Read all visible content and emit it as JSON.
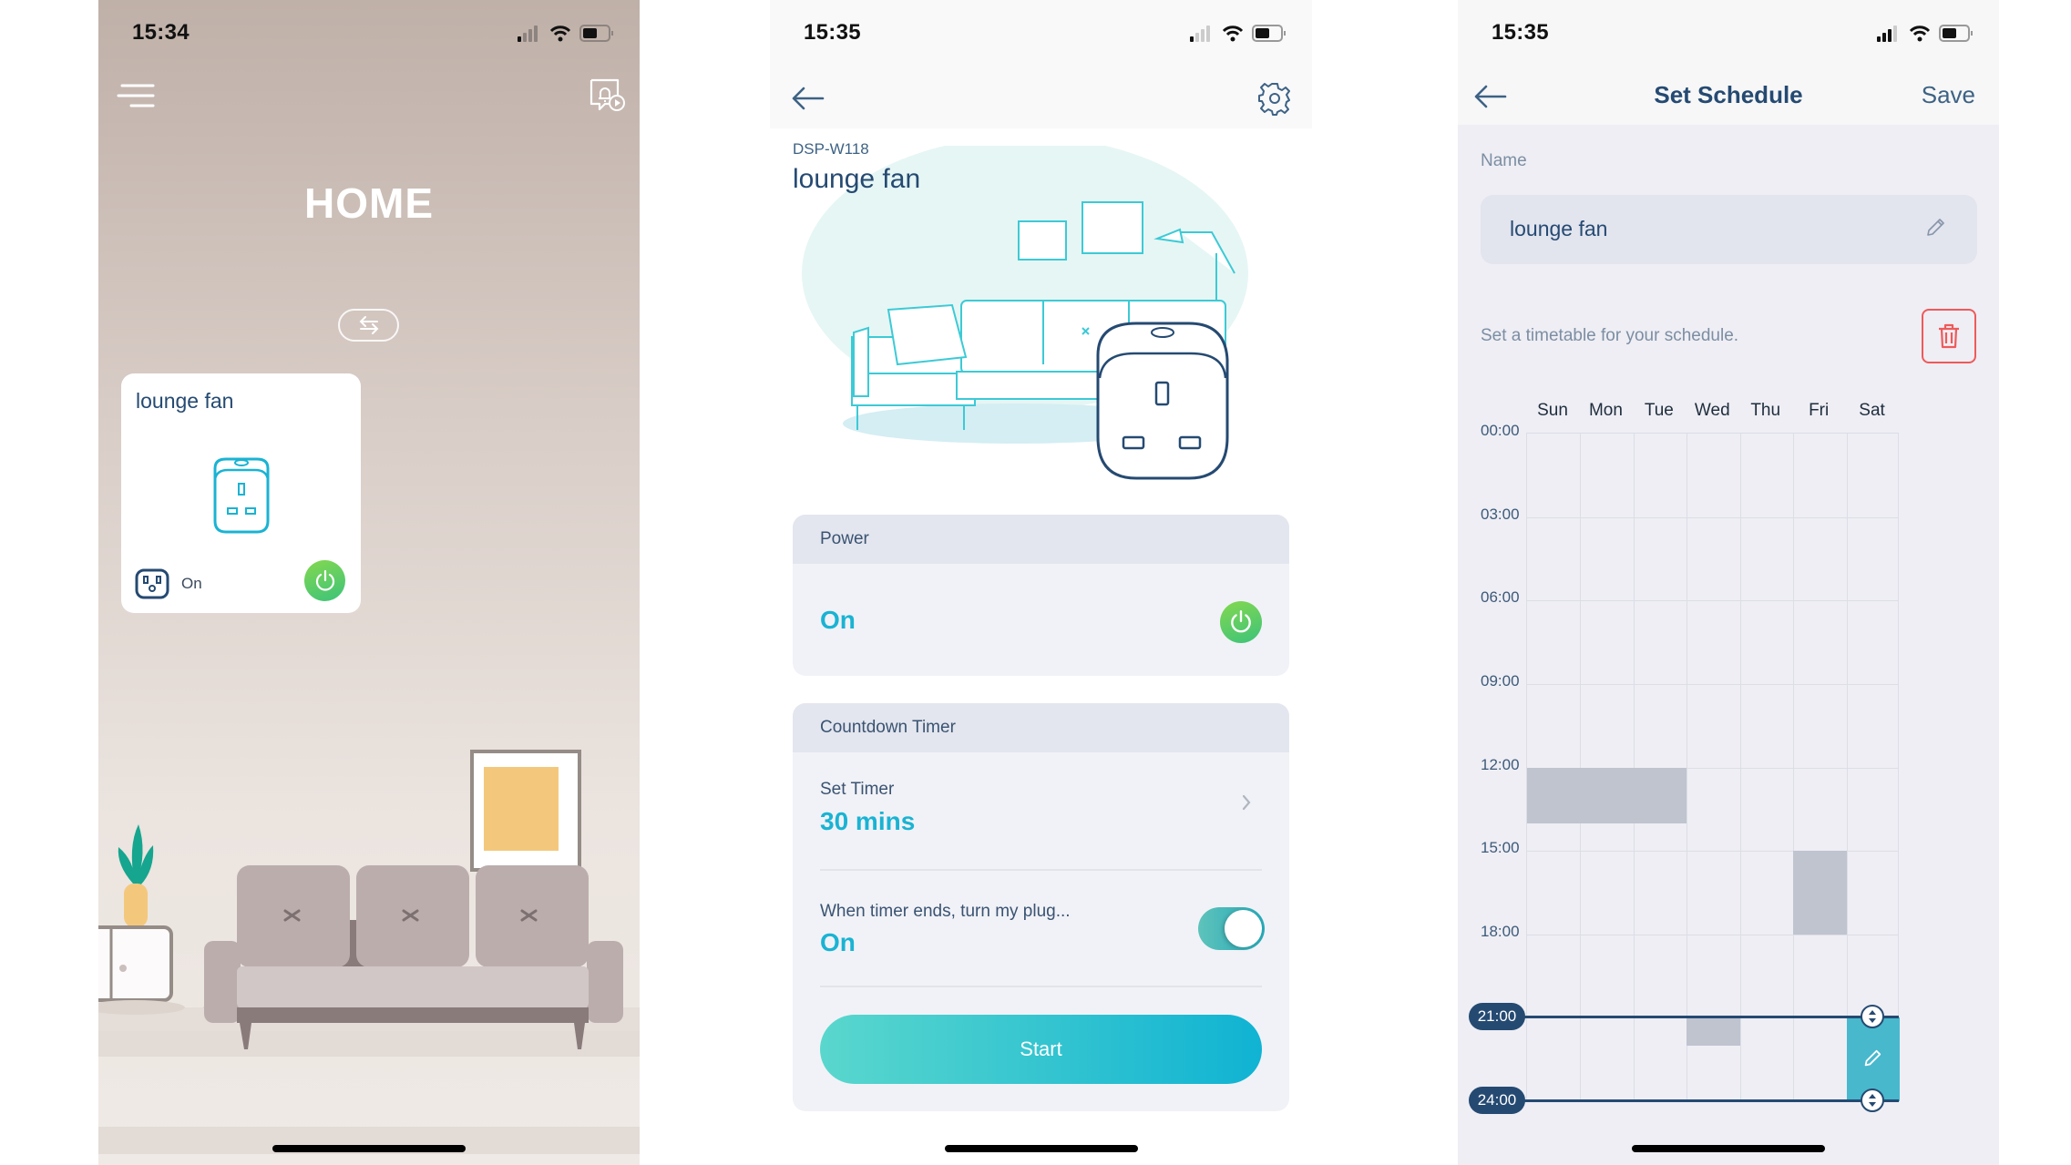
{
  "panels": {
    "home": {
      "status_time": "15:34",
      "title": "HOME",
      "device_card": {
        "name": "lounge fan",
        "status": "On",
        "power_state": "on"
      }
    },
    "device": {
      "status_time": "15:35",
      "model": "DSP-W118",
      "name": "lounge fan",
      "power": {
        "section_title": "Power",
        "value": "On"
      },
      "countdown": {
        "section_title": "Countdown Timer",
        "set_timer_label": "Set Timer",
        "set_timer_value": "30 mins",
        "end_action_label": "When timer ends, turn my plug...",
        "end_action_value": "On",
        "end_action_toggle": true,
        "start_label": "Start"
      }
    },
    "schedule": {
      "status_time": "15:35",
      "title": "Set Schedule",
      "save_label": "Save",
      "name_label": "Name",
      "name_value": "lounge fan",
      "hint": "Set a timetable for your schedule.",
      "days": [
        "Sun",
        "Mon",
        "Tue",
        "Wed",
        "Thu",
        "Fri",
        "Sat"
      ],
      "hours": [
        "00:00",
        "03:00",
        "06:00",
        "09:00",
        "12:00",
        "15:00",
        "18:00"
      ],
      "blocks": [
        {
          "day": 0,
          "start": 12,
          "end": 14
        },
        {
          "day": 1,
          "start": 12,
          "end": 14
        },
        {
          "day": 2,
          "start": 12,
          "end": 14
        },
        {
          "day": 5,
          "start": 15,
          "end": 18
        },
        {
          "day": 3,
          "start": 21,
          "end": 22
        }
      ],
      "selected": {
        "day": 6,
        "start": 21,
        "end": 24,
        "start_label": "21:00",
        "end_label": "24:00"
      }
    }
  },
  "colors": {
    "accent": "#1ab3d3",
    "navy": "#254a72",
    "power_green": "#4cc86a",
    "danger": "#ee5a5a",
    "block_gray": "#bfc4cf",
    "selected_block": "#48b8cd"
  }
}
